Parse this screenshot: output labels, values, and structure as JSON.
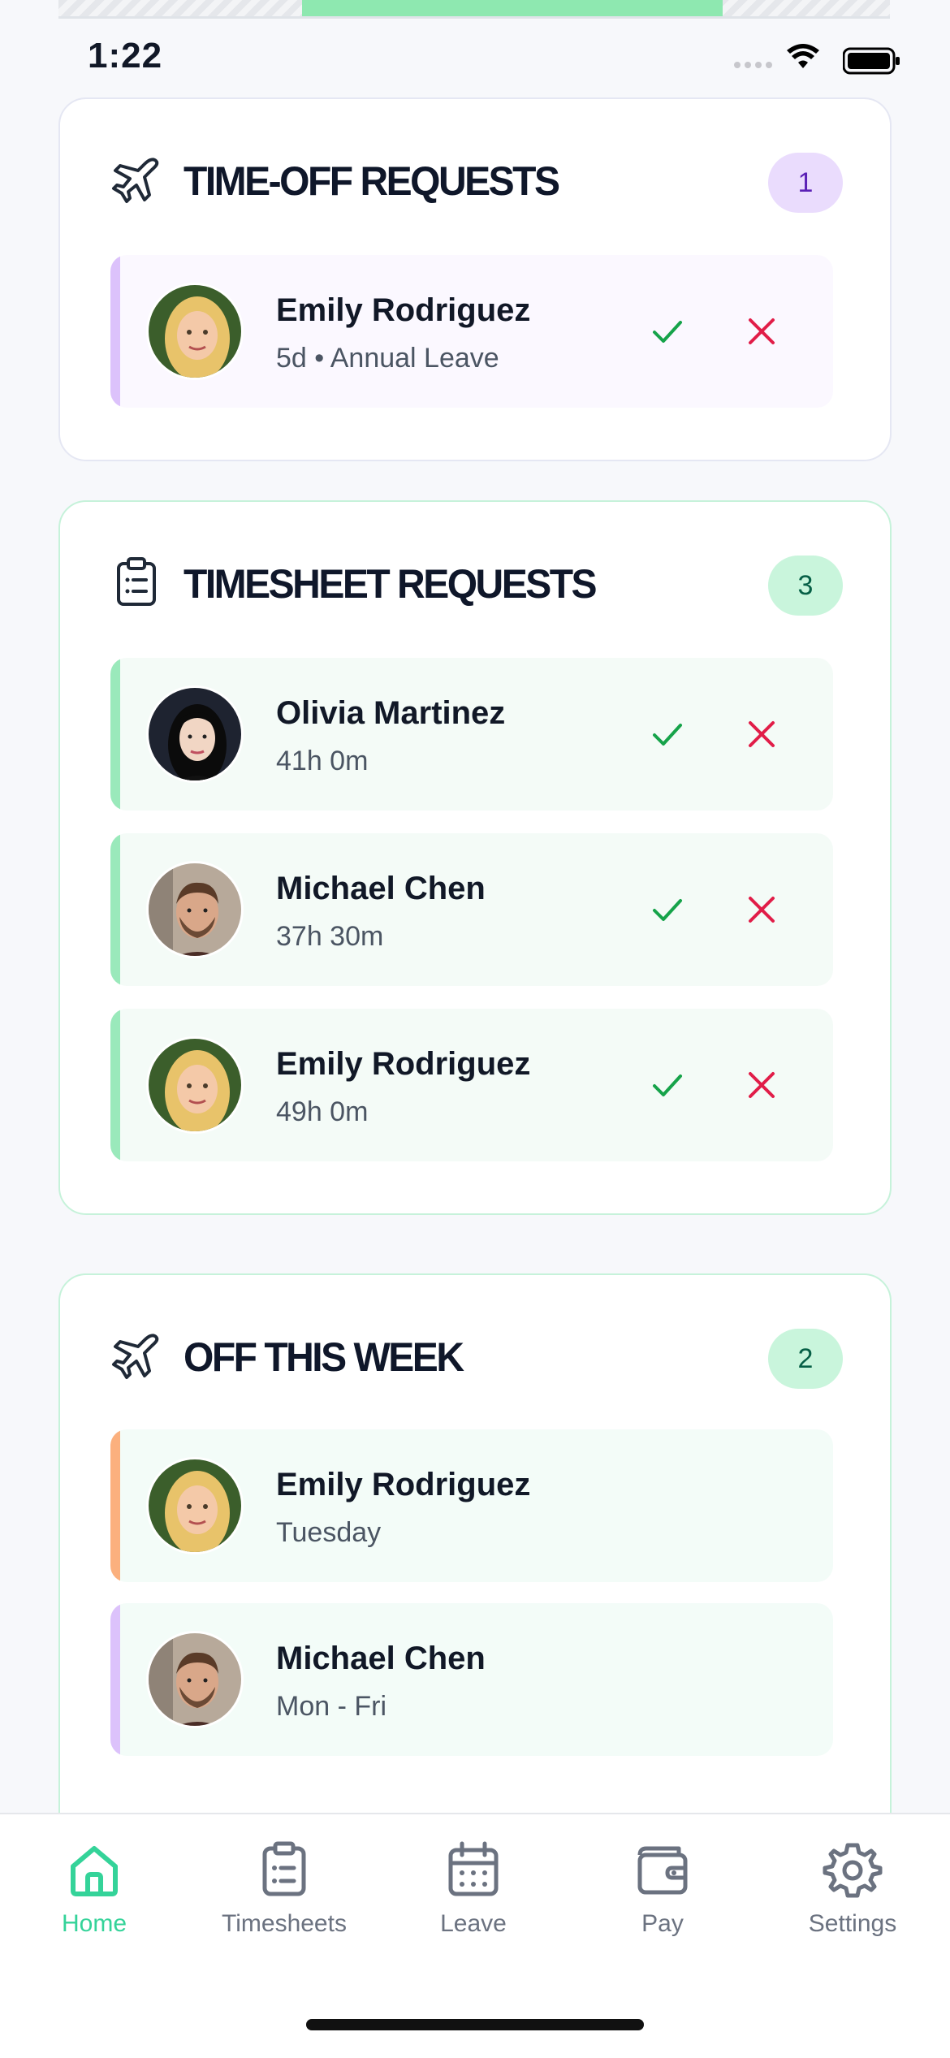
{
  "status_bar": {
    "time": "1:22"
  },
  "sections": {
    "time_off": {
      "title": "TIME-OFF REQUESTS",
      "count": "1",
      "icon": "airplane-icon",
      "items": [
        {
          "name": "Emily Rodriguez",
          "detail": "5d • Annual Leave",
          "avatar": "emily"
        }
      ]
    },
    "timesheet": {
      "title": "TIMESHEET REQUESTS",
      "count": "3",
      "icon": "clipboard-icon",
      "items": [
        {
          "name": "Olivia Martinez",
          "detail": "41h 0m",
          "avatar": "olivia"
        },
        {
          "name": "Michael Chen",
          "detail": "37h 30m",
          "avatar": "michael"
        },
        {
          "name": "Emily Rodriguez",
          "detail": "49h 0m",
          "avatar": "emily"
        }
      ]
    },
    "off_this_week": {
      "title": "OFF THIS WEEK",
      "count": "2",
      "icon": "airplane-icon",
      "items": [
        {
          "name": "Emily Rodriguez",
          "detail": "Tuesday",
          "avatar": "emily"
        },
        {
          "name": "Michael Chen",
          "detail": "Mon - Fri",
          "avatar": "michael"
        }
      ]
    }
  },
  "tabs": [
    {
      "label": "Home",
      "icon": "home-icon",
      "active": true
    },
    {
      "label": "Timesheets",
      "icon": "clipboard-icon",
      "active": false
    },
    {
      "label": "Leave",
      "icon": "calendar-icon",
      "active": false
    },
    {
      "label": "Pay",
      "icon": "wallet-icon",
      "active": false
    },
    {
      "label": "Settings",
      "icon": "gear-icon",
      "active": false
    }
  ],
  "colors": {
    "accent": "#34d399",
    "purple_badge": "#eadcfd",
    "green_badge": "#c9f5dc",
    "approve": "#16a34a",
    "reject": "#e11d48"
  }
}
